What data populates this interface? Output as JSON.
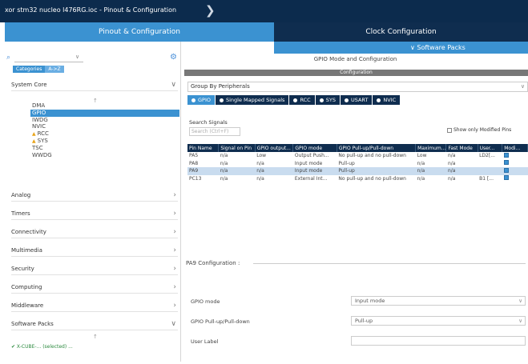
{
  "titlebar": {
    "breadcrumb": "xor stm32 nucleo l476RG.ioc - Pinout & Configuration"
  },
  "tabs": {
    "pinout": "Pinout & Configuration",
    "clock": "Clock Configuration"
  },
  "software_packs": "∨ Software Packs",
  "left": {
    "search_placeholder": "",
    "subtabs": [
      "Categories",
      "A->Z"
    ],
    "categories": [
      "System Core",
      "Analog",
      "Timers",
      "Connectivity",
      "Multimedia",
      "Security",
      "Computing",
      "Middleware",
      "Software Packs"
    ],
    "system_core_items": [
      "DMA",
      "GPIO",
      "IWDG",
      "NVIC",
      "RCC",
      "SYS",
      "TSC",
      "WWDG"
    ],
    "selected_item": "GPIO",
    "bottom_note": "✔ X-CUBE-... (selected) ..."
  },
  "main": {
    "mode_title": "GPIO Mode and Configuration",
    "config_bar": "Configuration",
    "group_by": "Group By Peripherals",
    "peripheral_tabs": [
      "GPIO",
      "Single Mapped Signals",
      "RCC",
      "SYS",
      "USART",
      "NVIC"
    ],
    "search_signals_label": "Search Signals",
    "search_placeholder": "Search (Ctrl+F)",
    "show_modified": "Show only Modified Pins",
    "table": {
      "headers": [
        "Pin Name",
        "Signal on Pin",
        "GPIO output...",
        "GPIO mode",
        "GPIO Pull-up/Pull-down",
        "Maximum...",
        "Fast Mode",
        "User...",
        "Modi..."
      ],
      "rows": [
        [
          "PA5",
          "n/a",
          "Low",
          "Output Push...",
          "No pull-up and no pull-down",
          "Low",
          "n/a",
          "LD2[...",
          ""
        ],
        [
          "PA8",
          "n/a",
          "n/a",
          "Input mode",
          "Pull-up",
          "n/a",
          "n/a",
          "",
          ""
        ],
        [
          "PA9",
          "n/a",
          "n/a",
          "Input mode",
          "Pull-up",
          "n/a",
          "n/a",
          "",
          ""
        ],
        [
          "PC13",
          "n/a",
          "n/a",
          "External Int...",
          "No pull-up and no pull-down",
          "n/a",
          "n/a",
          "B1 [...",
          ""
        ]
      ]
    },
    "pa5_config": "PA9 Configuration :",
    "fields": [
      {
        "label": "GPIO mode",
        "value": "Input mode"
      },
      {
        "label": "GPIO Pull-up/Pull-down",
        "value": "Pull-up"
      },
      {
        "label": "User Label",
        "value": ""
      }
    ]
  },
  "colors": {
    "titlebar": "#0c2b4d",
    "accent": "#3b92d1",
    "dark_tab": "#0f2d4f",
    "warning": "#e8a317"
  }
}
